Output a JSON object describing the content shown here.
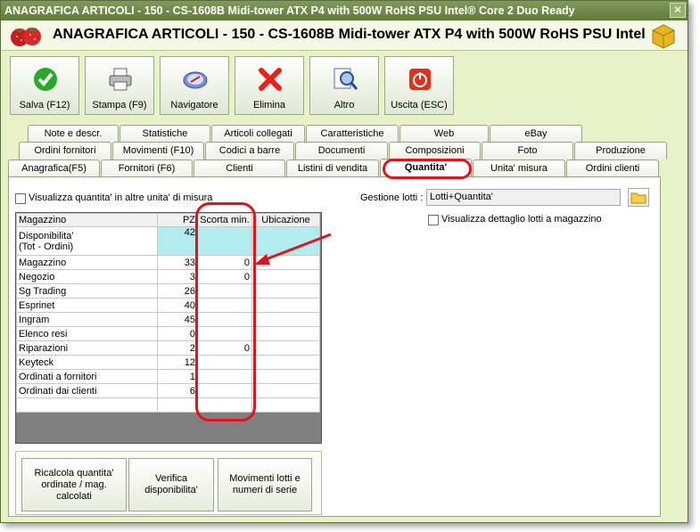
{
  "window": {
    "title": "ANAGRAFICA ARTICOLI - 150 - CS-1608B Midi-tower ATX P4 with 500W RoHS PSU Intel® Core 2 Duo Ready",
    "close_label": "✕"
  },
  "header": {
    "title": "ANAGRAFICA ARTICOLI - 150 - CS-1608B Midi-tower ATX P4 with 500W RoHS PSU Intel"
  },
  "toolbar": {
    "buttons": [
      {
        "label": "Salva (F12)",
        "icon": "check-icon"
      },
      {
        "label": "Stampa (F9)",
        "icon": "printer-icon"
      },
      {
        "label": "Navigatore",
        "icon": "compass-icon"
      },
      {
        "label": "Elimina",
        "icon": "delete-x-icon"
      },
      {
        "label": "Altro",
        "icon": "magnifier-icon"
      },
      {
        "label": "Uscita (ESC)",
        "icon": "exit-icon"
      }
    ]
  },
  "tabs": {
    "row1": [
      "Note e descr.",
      "Statistiche",
      "Articoli collegati",
      "Caratteristiche",
      "Web",
      "eBay"
    ],
    "row2": [
      "Ordini fornitori",
      "Movimenti (F10)",
      "Codici a barre",
      "Documenti",
      "Composizioni",
      "Foto",
      "Produzione"
    ],
    "row3": [
      "Anagrafica(F5)",
      "Fornitori (F6)",
      "Clienti",
      "Listini di vendita",
      "Quantita'",
      "Unita' misura",
      "Ordini clienti"
    ]
  },
  "quantity_page": {
    "alt_units_label": "Visualizza quantita' in altre unita' di misura",
    "lot_management_label": "Gestione lotti :",
    "lot_management_value": "Lotti+Quantita'",
    "lot_detail_label": "Visualizza dettaglio lotti a magazzino",
    "table": {
      "headers": [
        "Magazzino",
        "PZ",
        "Scorta min.",
        "Ubicazione"
      ],
      "rows": [
        {
          "name": "Disponibilita'",
          "name2": "(Tot - Ordini)",
          "pz": "42",
          "scorta": "",
          "ubic": ""
        },
        {
          "name": "Magazzino",
          "pz": "33",
          "scorta": "0",
          "ubic": ""
        },
        {
          "name": "Negozio",
          "pz": "3",
          "scorta": "0",
          "ubic": ""
        },
        {
          "name": "Sg Trading",
          "pz": "26",
          "scorta": "",
          "ubic": ""
        },
        {
          "name": "Esprinet",
          "pz": "40",
          "scorta": "",
          "ubic": ""
        },
        {
          "name": "Ingram",
          "pz": "45",
          "scorta": "",
          "ubic": ""
        },
        {
          "name": "Elenco resi",
          "pz": "0",
          "scorta": "",
          "ubic": ""
        },
        {
          "name": "Riparazioni",
          "pz": "2",
          "scorta": "0",
          "ubic": ""
        },
        {
          "name": "Keyteck",
          "pz": "12",
          "scorta": "",
          "ubic": ""
        },
        {
          "name": "Ordinati a fornitori",
          "pz": "1",
          "scorta": "",
          "ubic": ""
        },
        {
          "name": "Ordinati dai clienti",
          "pz": "6",
          "scorta": "",
          "ubic": ""
        }
      ]
    },
    "actions": [
      "Ricalcola quantita' ordinate / mag. calcolati",
      "Verifica disponibilita'",
      "Movimenti lotti e numeri di serie"
    ]
  },
  "colors": {
    "window_bg": "#e8f2c6",
    "titlebar": "#6f8a4a",
    "highlight": "#e0141c",
    "cyan_cell": "#b2ecef"
  }
}
